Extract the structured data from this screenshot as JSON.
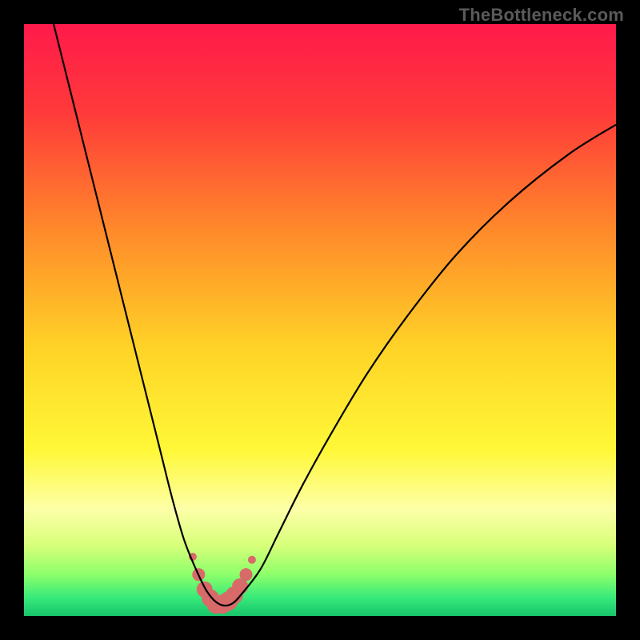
{
  "watermark": "TheBottleneck.com",
  "chart_data": {
    "type": "line",
    "title": "",
    "xlabel": "",
    "ylabel": "",
    "xlim": [
      0,
      100
    ],
    "ylim": [
      0,
      100
    ],
    "series": [
      {
        "name": "bottleneck-curve",
        "x": [
          5,
          8,
          11,
          14,
          17,
          20,
          23,
          25,
          27,
          29,
          31,
          33,
          35,
          37,
          40,
          43,
          47,
          52,
          58,
          65,
          73,
          82,
          92,
          100
        ],
        "values": [
          100,
          88,
          76,
          64,
          52,
          40,
          28,
          20,
          13,
          8,
          4,
          2,
          2,
          4,
          8,
          14,
          22,
          31,
          41,
          51,
          61,
          70,
          78,
          83
        ]
      }
    ],
    "highlight": {
      "name": "optimal-range",
      "x": [
        28.5,
        29.5,
        30.5,
        31.5,
        32.5,
        33.5,
        34.5,
        35.5,
        36.5,
        37.5,
        38.5
      ],
      "values": [
        10,
        7,
        4.5,
        3,
        2,
        2,
        2.5,
        3.5,
        5,
        7,
        9.5
      ],
      "radii": [
        5,
        8,
        10,
        11,
        12,
        12,
        12,
        11,
        10,
        8,
        5
      ]
    },
    "gradient": {
      "stops": [
        {
          "offset": 0.0,
          "color": "#ff1a4b"
        },
        {
          "offset": 0.15,
          "color": "#ff3a3a"
        },
        {
          "offset": 0.35,
          "color": "#ff8a2a"
        },
        {
          "offset": 0.55,
          "color": "#ffd427"
        },
        {
          "offset": 0.72,
          "color": "#fff838"
        },
        {
          "offset": 0.82,
          "color": "#fdffa8"
        },
        {
          "offset": 0.88,
          "color": "#d8ff7a"
        },
        {
          "offset": 0.93,
          "color": "#8cff6a"
        },
        {
          "offset": 0.97,
          "color": "#35e97a"
        },
        {
          "offset": 1.0,
          "color": "#18c46a"
        }
      ]
    },
    "highlight_color": "#d86a6a",
    "curve_color": "#000000"
  }
}
